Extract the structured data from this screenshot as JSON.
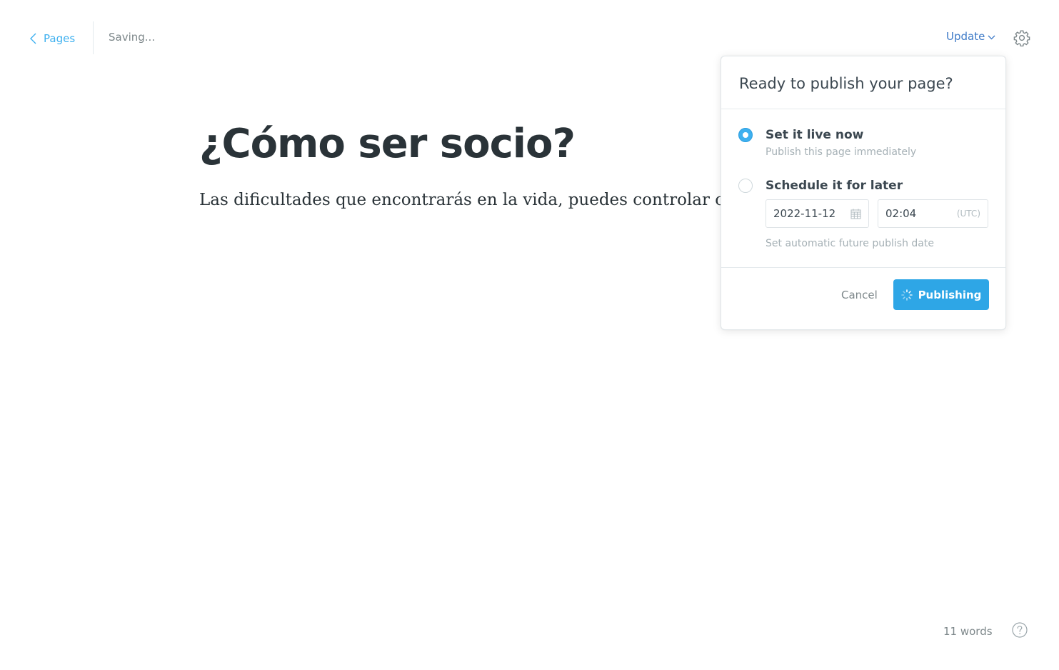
{
  "topbar": {
    "back_label": "Pages",
    "status": "Saving...",
    "update_label": "Update"
  },
  "editor": {
    "title": "¿Cómo ser socio?",
    "body": "Las dificultades que encontrarás en la vida, puedes controlar cóm"
  },
  "publish_menu": {
    "heading": "Ready to publish your page?",
    "options": [
      {
        "label": "Set it live now",
        "hint": "Publish this page immediately",
        "selected": true
      },
      {
        "label": "Schedule it for later",
        "selected": false
      }
    ],
    "date_value": "2022-11-12",
    "time_value": "02:04",
    "timezone": "(UTC)",
    "schedule_hint": "Set automatic future publish date",
    "cancel_label": "Cancel",
    "publish_label": "Publishing"
  },
  "footer": {
    "word_count": "11 words"
  },
  "colors": {
    "accent": "#3eb0ef",
    "update_link": "#3d7ac7",
    "publish_button": "#2ea6e6"
  },
  "icons": [
    "chevron-left-icon",
    "chevron-down-icon",
    "gear-icon",
    "calendar-icon",
    "spinner-icon",
    "help-icon"
  ]
}
